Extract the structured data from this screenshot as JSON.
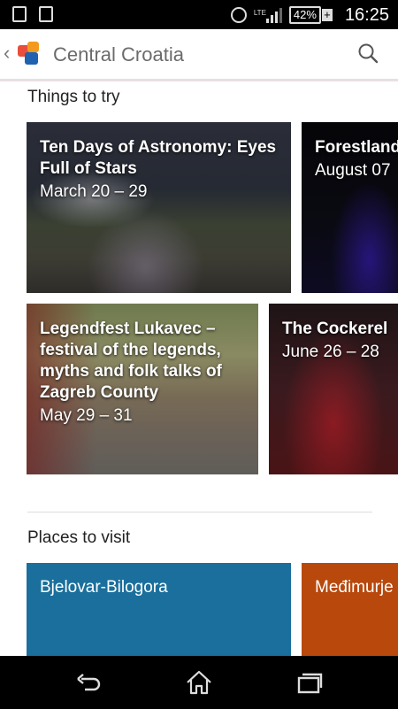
{
  "status_bar": {
    "time": "16:25",
    "battery": "42%",
    "network": "LTE"
  },
  "app_bar": {
    "title": "Central Croatia"
  },
  "things_to_try": {
    "heading": "Things to try",
    "cards": [
      {
        "name": "Ten Days of Astronomy: Eyes Full of Stars",
        "date": "March 20 – 29"
      },
      {
        "name": "Forestland",
        "date": "August 07"
      },
      {
        "name": "Legendfest Lukavec – festival of the legends, myths and folk talks of Zagreb County",
        "date": "May 29 – 31"
      },
      {
        "name": "The Cockerel",
        "date": "June 26 – 28"
      }
    ]
  },
  "places_to_visit": {
    "heading": "Places to visit",
    "tiles": [
      {
        "name": "Bjelovar-Bilogora",
        "color": "#1a6f9c"
      },
      {
        "name": "Međimurje",
        "color": "#b8480c"
      }
    ]
  }
}
